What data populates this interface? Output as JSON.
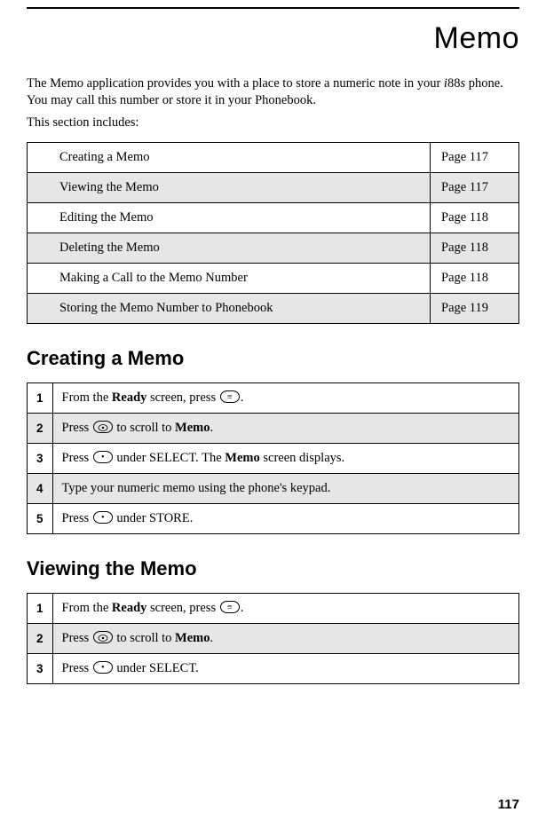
{
  "title": "Memo",
  "intro_para1_a": "The Memo application provides you with a place to store a numeric note in your ",
  "intro_para1_b": "i",
  "intro_para1_c": "88",
  "intro_para1_d": "s",
  "intro_para1_e": " phone. You may call this number or store it in your Phonebook.",
  "intro_para2": "This section includes:",
  "toc": [
    {
      "label": "Creating a Memo",
      "page": "Page 117"
    },
    {
      "label": "Viewing the Memo",
      "page": "Page 117"
    },
    {
      "label": "Editing the Memo",
      "page": "Page 118"
    },
    {
      "label": "Deleting the Memo",
      "page": "Page 118"
    },
    {
      "label": "Making a Call to the Memo Number",
      "page": "Page 118"
    },
    {
      "label": "Storing the Memo Number to Phonebook",
      "page": "Page 119"
    }
  ],
  "section1_heading": "Creating a Memo",
  "section1_steps": {
    "s1": "1",
    "s1_a": "From the ",
    "s1_b": "Ready",
    "s1_c": " screen, press ",
    "s1_d": ".",
    "s2": "2",
    "s2_a": "Press ",
    "s2_b": " to scroll to ",
    "s2_c": "Memo",
    "s2_d": ".",
    "s3": "3",
    "s3_a": "Press ",
    "s3_b": " under SELECT. The ",
    "s3_c": "Memo",
    "s3_d": " screen displays.",
    "s4": "4",
    "s4_a": "Type your numeric memo using the phone's keypad.",
    "s5": "5",
    "s5_a": "Press ",
    "s5_b": " under STORE."
  },
  "section2_heading": "Viewing the Memo",
  "section2_steps": {
    "s1": "1",
    "s1_a": "From the ",
    "s1_b": "Ready",
    "s1_c": " screen, press ",
    "s1_d": ".",
    "s2": "2",
    "s2_a": "Press ",
    "s2_b": " to scroll to ",
    "s2_c": "Memo",
    "s2_d": ".",
    "s3": "3",
    "s3_a": "Press ",
    "s3_b": " under SELECT."
  },
  "page_number": "117"
}
